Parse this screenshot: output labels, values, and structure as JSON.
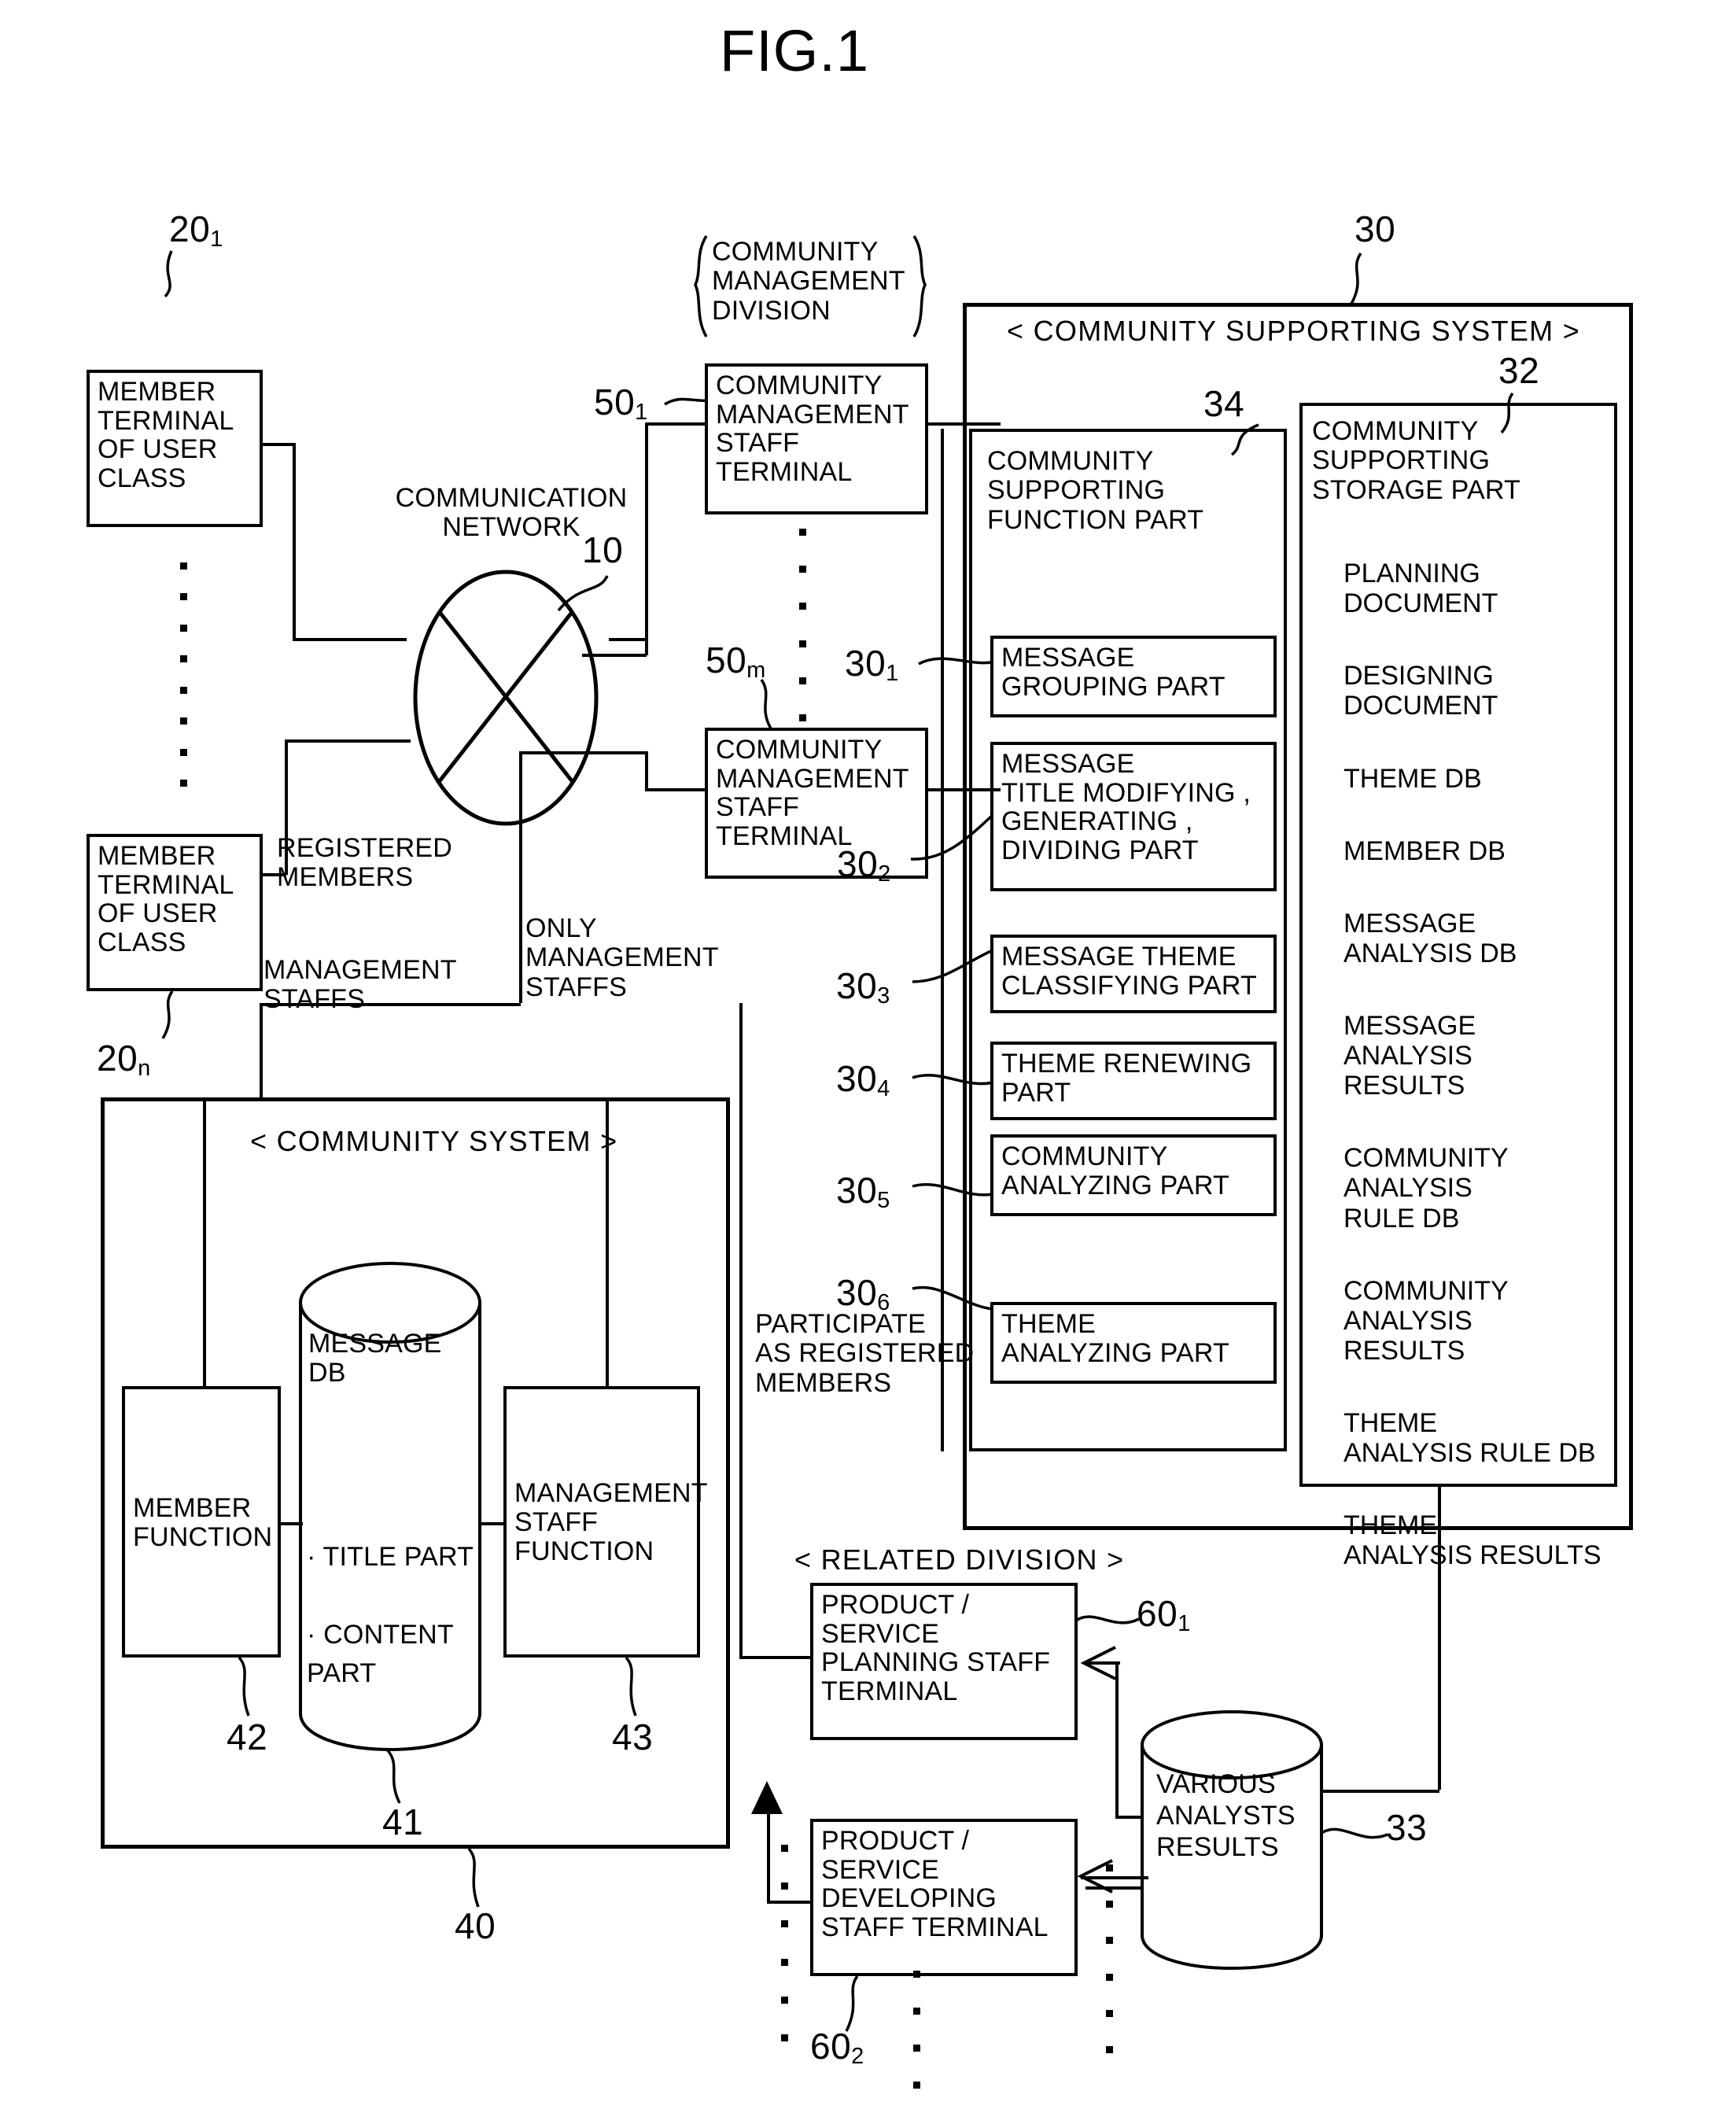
{
  "figure": {
    "title": "FIG.1"
  },
  "nodes": {
    "member_terminal_1": {
      "label": "MEMBER\nTERMINAL\nOF USER\nCLASS",
      "ref": "20",
      "sub": "1"
    },
    "member_terminal_n": {
      "label": "MEMBER\nTERMINAL\nOF USER\nCLASS",
      "ref": "20",
      "sub": "n"
    },
    "network": {
      "label": "COMMUNICATION\nNETWORK",
      "ref": "10"
    },
    "cm_division_label": "COMMUNITY\nMANAGEMENT\nDIVISION",
    "cm_staff_terminal_1": {
      "label": "COMMUNITY\nMANAGEMENT\nSTAFF\nTERMINAL",
      "ref": "50",
      "sub": "1"
    },
    "cm_staff_terminal_m": {
      "label": "COMMUNITY\nMANAGEMENT\nSTAFF\nTERMINAL",
      "ref": "50",
      "sub": "m"
    }
  },
  "edge_labels": {
    "registered_members": "REGISTERED\nMEMBERS",
    "management_staffs": "MANAGEMENT\nSTAFFS",
    "only_management_staffs": "ONLY\nMANAGEMENT\nSTAFFS",
    "participate_as_registered_members": "PARTICIPATE\nAS REGISTERED\nMEMBERS"
  },
  "community_supporting_system": {
    "header": "< COMMUNITY SUPPORTING SYSTEM >",
    "ref": "30",
    "function_part": {
      "title": "COMMUNITY\nSUPPORTING\nFUNCTION PART",
      "ref": "34",
      "parts": [
        {
          "label": "MESSAGE\nGROUPING PART",
          "ref": "30",
          "sub": "1"
        },
        {
          "label": "MESSAGE\nTITLE MODIFYING ,\nGENERATING ,\nDIVIDING PART",
          "ref": "30",
          "sub": "2"
        },
        {
          "label": "MESSAGE THEME\nCLASSIFYING PART",
          "ref": "30",
          "sub": "3"
        },
        {
          "label": "THEME RENEWING\nPART",
          "ref": "30",
          "sub": "4"
        },
        {
          "label": "COMMUNITY\nANALYZING PART",
          "ref": "30",
          "sub": "5"
        },
        {
          "label": "THEME\nANALYZING PART",
          "ref": "30",
          "sub": "6"
        }
      ]
    },
    "storage_part": {
      "title": "COMMUNITY\nSUPPORTING\nSTORAGE PART",
      "ref": "32",
      "items": [
        "PLANNING\nDOCUMENT",
        "DESIGNING\nDOCUMENT",
        "THEME DB",
        "MEMBER DB",
        "MESSAGE\nANALYSIS DB",
        "MESSAGE\nANALYSIS\nRESULTS",
        "COMMUNITY\nANALYSIS\nRULE DB",
        "COMMUNITY\nANALYSIS\nRESULTS",
        "THEME\nANALYSIS RULE DB",
        "THEME\nANALYSIS RESULTS"
      ]
    }
  },
  "community_system": {
    "header": "< COMMUNITY SYSTEM >",
    "ref": "40",
    "message_db": {
      "label": "MESSAGE\nDB",
      "items": "· TITLE PART\n\n· CONTENT\n  PART",
      "ref": "41"
    },
    "member_function": {
      "label": "MEMBER\nFUNCTION",
      "ref": "42"
    },
    "management_staff_function": {
      "label": "MANAGEMENT\nSTAFF\nFUNCTION",
      "ref": "43"
    }
  },
  "related_division": {
    "header": "< RELATED DIVISION >",
    "planning_terminal": {
      "label": "PRODUCT /\nSERVICE\nPLANNING STAFF\nTERMINAL",
      "ref": "60",
      "sub": "1"
    },
    "developing_terminal": {
      "label": "PRODUCT /\nSERVICE\nDEVELOPING\nSTAFF TERMINAL",
      "ref": "60",
      "sub": "2"
    },
    "analysts_results": {
      "label": "VARIOUS\nANALYSTS\nRESULTS",
      "ref": "33"
    }
  },
  "colors": {
    "ink": "#000000",
    "paper": "#ffffff"
  }
}
